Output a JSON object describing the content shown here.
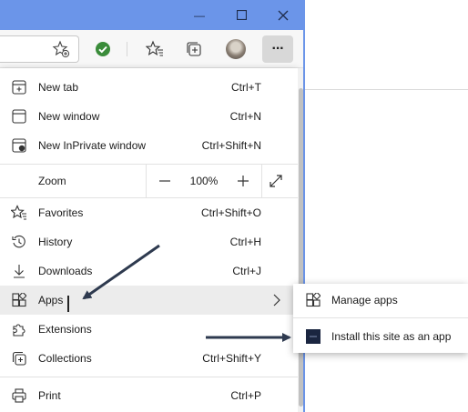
{
  "window": {
    "minimize_glyph": "—",
    "maximize_glyph": "☐",
    "close_glyph": "✕"
  },
  "toolbar": {
    "icons": [
      "add-favorite-icon",
      "extension-check-icon",
      "favorites-icon",
      "collections-icon",
      "profile-avatar",
      "more-icon"
    ],
    "more_glyph": "···"
  },
  "menu": {
    "items": [
      {
        "label": "New tab",
        "shortcut": "Ctrl+T",
        "icon": "new-tab-icon"
      },
      {
        "label": "New window",
        "shortcut": "Ctrl+N",
        "icon": "new-window-icon"
      },
      {
        "label": "New InPrivate window",
        "shortcut": "Ctrl+Shift+N",
        "icon": "inprivate-icon"
      }
    ],
    "zoom": {
      "label": "Zoom",
      "value": "100%",
      "minus": "—",
      "plus": "+"
    },
    "items2": [
      {
        "label": "Favorites",
        "shortcut": "Ctrl+Shift+O",
        "icon": "favorites-icon"
      },
      {
        "label": "History",
        "shortcut": "Ctrl+H",
        "icon": "history-icon"
      },
      {
        "label": "Downloads",
        "shortcut": "Ctrl+J",
        "icon": "downloads-icon"
      },
      {
        "label": "Apps",
        "shortcut": "",
        "icon": "apps-icon"
      },
      {
        "label": "Extensions",
        "shortcut": "",
        "icon": "extensions-icon"
      },
      {
        "label": "Collections",
        "shortcut": "Ctrl+Shift+Y",
        "icon": "collections-icon"
      }
    ],
    "items3": [
      {
        "label": "Print",
        "shortcut": "Ctrl+P",
        "icon": "print-icon"
      }
    ]
  },
  "submenu": {
    "items": [
      {
        "label": "Manage apps",
        "icon": "apps-icon"
      },
      {
        "label": "Install this site as an app",
        "icon": "install-app-icon"
      }
    ]
  },
  "colors": {
    "titlebar": "#6b95e9",
    "highlight": "#ececec",
    "arrow": "#2e3a4f",
    "check": "#3a8c3a"
  }
}
